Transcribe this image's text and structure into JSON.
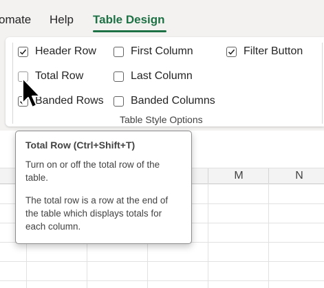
{
  "menu": {
    "tabs": [
      {
        "label": "omate"
      },
      {
        "label": "Help"
      },
      {
        "label": "Table Design"
      }
    ]
  },
  "ribbon": {
    "options": [
      {
        "label": "Header Row",
        "checked": true
      },
      {
        "label": "Total Row",
        "checked": false
      },
      {
        "label": "Banded Rows",
        "checked": true
      },
      {
        "label": "First Column",
        "checked": false
      },
      {
        "label": "Last Column",
        "checked": false
      },
      {
        "label": "Banded Columns",
        "checked": false
      },
      {
        "label": "Filter Button",
        "checked": true
      }
    ],
    "group_label": "Table Style Options"
  },
  "grid": {
    "column_headers": [
      "M",
      "N"
    ]
  },
  "tooltip": {
    "title": "Total Row (Ctrl+Shift+T)",
    "paragraph1": "Turn on or off the total row of the table.",
    "paragraph2": "The total row is a row at the end of the table which displays totals for each column."
  },
  "colors": {
    "accent": "#1e7145",
    "ribbon_bg": "#f3f2f1"
  }
}
